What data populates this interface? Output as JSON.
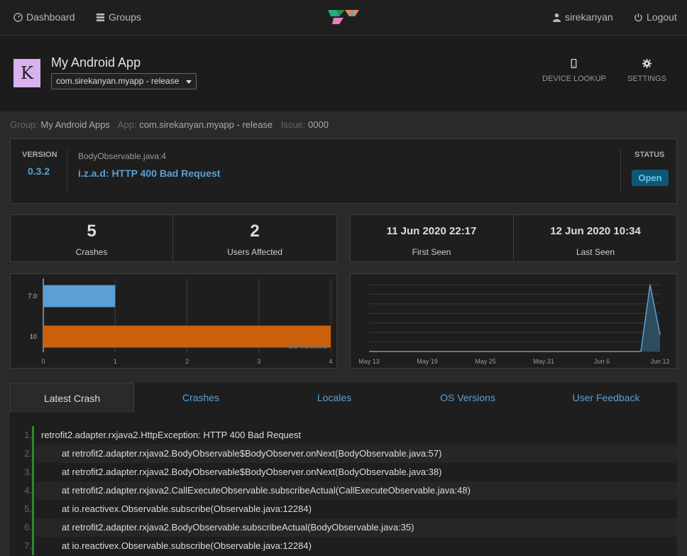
{
  "nav": {
    "dashboard_label": "Dashboard",
    "groups_label": "Groups",
    "user_label": "sirekanyan",
    "logout_label": "Logout"
  },
  "app": {
    "title": "My Android App",
    "avatar_letter": "K",
    "selected_app": "com.sirekanyan.myapp - release"
  },
  "header_actions": {
    "device_lookup": "DEVICE LOOKUP",
    "settings": "SETTINGS"
  },
  "breadcrumb": {
    "group_label": "Group:",
    "group_value": "My Android Apps",
    "app_label": "App:",
    "app_value": "com.sirekanyan.myapp - release",
    "issue_label": "Issue:",
    "issue_value": "0000"
  },
  "issue": {
    "version_label": "VERSION",
    "version_value": "0.3.2",
    "file": "BodyObservable.java:4",
    "title": "i.z.a.d: HTTP 400 Bad Request",
    "status_label": "STATUS",
    "status_value": "Open"
  },
  "stats": {
    "crashes_count": "5",
    "crashes_label": "Crashes",
    "users_count": "2",
    "users_label": "Users Affected",
    "first_seen": "11 Jun 2020 22:17",
    "first_seen_label": "First Seen",
    "last_seen": "12 Jun 2020 10:34",
    "last_seen_label": "Last Seen"
  },
  "chart_data": [
    {
      "type": "bar",
      "orientation": "horizontal",
      "categories": [
        "7.0",
        "10"
      ],
      "values": [
        1,
        4
      ],
      "colors": [
        "#5aa0d4",
        "#cc5f0a"
      ],
      "xlabel": "OS Versions",
      "xlim": [
        0,
        4
      ],
      "xticks": [
        "0",
        "1",
        "2",
        "3",
        "4"
      ],
      "grid": true
    },
    {
      "type": "area",
      "x": [
        "May 13",
        "May 19",
        "May 25",
        "May 31",
        "Jun 6",
        "Jun 12"
      ],
      "points": [
        {
          "x": "Jun 10",
          "y": 0
        },
        {
          "x": "Jun 11",
          "y": 4
        },
        {
          "x": "Jun 12",
          "y": 1
        }
      ],
      "baseline": 0,
      "ylim": [
        0,
        4
      ],
      "color": "#5aa0d4",
      "grid": true
    }
  ],
  "tabs": [
    {
      "label": "Latest Crash",
      "active": true
    },
    {
      "label": "Crashes",
      "active": false
    },
    {
      "label": "Locales",
      "active": false
    },
    {
      "label": "OS Versions",
      "active": false
    },
    {
      "label": "User Feedback",
      "active": false
    }
  ],
  "stacktrace": [
    {
      "no": "1.",
      "text": "retrofit2.adapter.rxjava2.HttpException: HTTP 400 Bad Request"
    },
    {
      "no": "2.",
      "text": "at retrofit2.adapter.rxjava2.BodyObservable$BodyObserver.onNext(BodyObservable.java:57)"
    },
    {
      "no": "3.",
      "text": "at retrofit2.adapter.rxjava2.BodyObservable$BodyObserver.onNext(BodyObservable.java:38)"
    },
    {
      "no": "4.",
      "text": "at retrofit2.adapter.rxjava2.CallExecuteObservable.subscribeActual(CallExecuteObservable.java:48)"
    },
    {
      "no": "5.",
      "text": "at io.reactivex.Observable.subscribe(Observable.java:12284)"
    },
    {
      "no": "6.",
      "text": "at retrofit2.adapter.rxjava2.BodyObservable.subscribeActual(BodyObservable.java:35)"
    },
    {
      "no": "7.",
      "text": "at io.reactivex.Observable.subscribe(Observable.java:12284)"
    }
  ]
}
